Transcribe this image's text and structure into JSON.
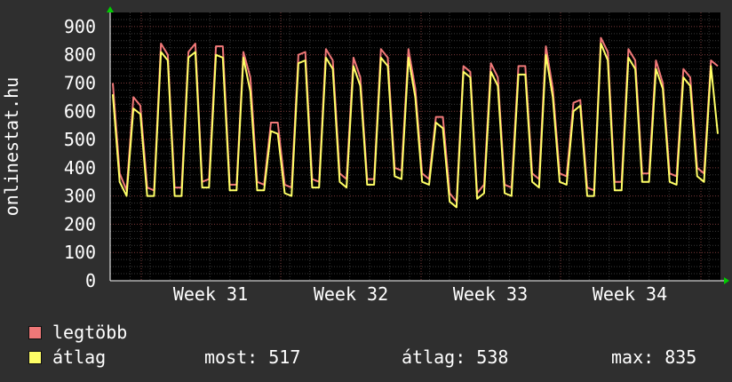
{
  "chart_data": {
    "type": "line",
    "ylabel": "onlinestat.hu",
    "yticks": [
      "0",
      "100",
      "200",
      "300",
      "400",
      "500",
      "600",
      "700",
      "800",
      "900"
    ],
    "ylim": [
      0,
      950
    ],
    "xticks": [
      "Week 31",
      "Week 32",
      "Week 33",
      "Week 34"
    ],
    "xlabel": "",
    "grid": true,
    "series": [
      {
        "name": "legtöbb",
        "color": "#f07878",
        "values": [
          700,
          380,
          320,
          650,
          620,
          330,
          320,
          840,
          800,
          330,
          330,
          810,
          840,
          350,
          360,
          830,
          830,
          340,
          340,
          810,
          720,
          350,
          340,
          560,
          560,
          340,
          330,
          800,
          810,
          360,
          350,
          820,
          780,
          380,
          360,
          790,
          720,
          360,
          360,
          820,
          790,
          400,
          390,
          820,
          680,
          380,
          360,
          580,
          580,
          310,
          280,
          760,
          740,
          310,
          340,
          770,
          720,
          340,
          330,
          760,
          760,
          380,
          360,
          830,
          680,
          380,
          370,
          630,
          640,
          330,
          320,
          860,
          810,
          350,
          350,
          820,
          780,
          380,
          380,
          780,
          700,
          380,
          370,
          750,
          720,
          400,
          380,
          780,
          760
        ]
      },
      {
        "name": "átlag",
        "color": "#ffff66",
        "values": [
          660,
          350,
          300,
          610,
          590,
          300,
          300,
          810,
          780,
          300,
          300,
          790,
          810,
          330,
          330,
          800,
          790,
          320,
          320,
          790,
          670,
          320,
          320,
          530,
          520,
          310,
          300,
          770,
          780,
          330,
          330,
          790,
          750,
          350,
          330,
          760,
          690,
          340,
          340,
          790,
          760,
          370,
          360,
          790,
          650,
          350,
          340,
          560,
          540,
          280,
          260,
          740,
          720,
          290,
          310,
          740,
          690,
          310,
          300,
          730,
          730,
          350,
          330,
          800,
          650,
          350,
          340,
          600,
          620,
          300,
          300,
          840,
          780,
          320,
          320,
          790,
          750,
          350,
          350,
          750,
          680,
          350,
          340,
          720,
          690,
          370,
          350,
          760,
          520
        ]
      }
    ]
  },
  "legend": {
    "items": [
      {
        "label": "legtöbb",
        "color": "#f07878"
      },
      {
        "label": "átlag",
        "color": "#ffff66"
      }
    ]
  },
  "stats": {
    "most": "most: 517",
    "atlag": "átlag: 538",
    "max": "max: 835"
  }
}
